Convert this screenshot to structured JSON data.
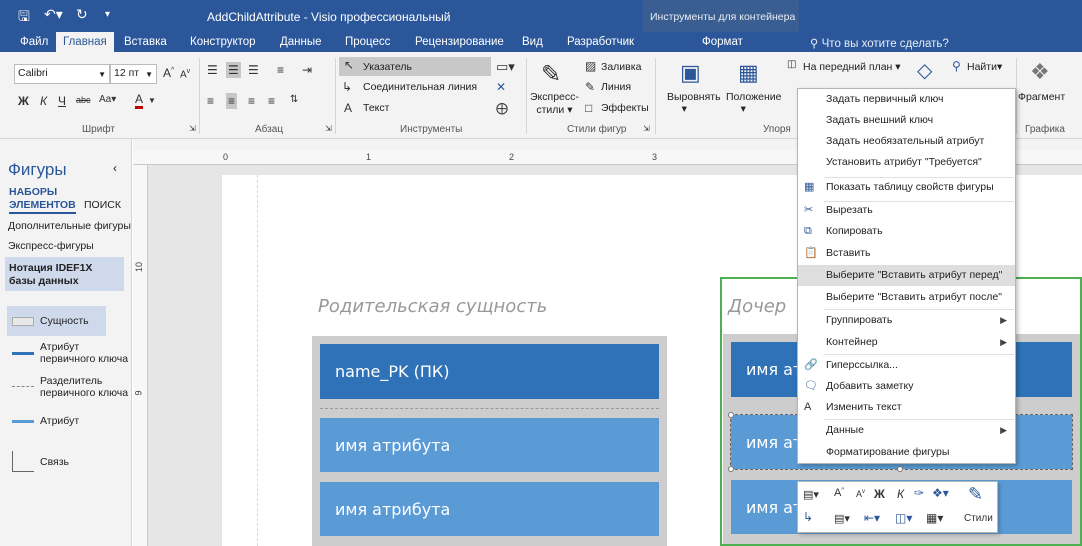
{
  "window": {
    "title": "AddChildAttribute - Visio профессиональный",
    "contextual_group": "Инструменты для контейнера"
  },
  "tabs": [
    "Файл",
    "Главная",
    "Вставка",
    "Конструктор",
    "Данные",
    "Процесс",
    "Рецензирование",
    "Вид",
    "Разработчик",
    "Формат"
  ],
  "tell_me": "Что вы хотите сделать?",
  "ribbon": {
    "font": {
      "name": "Calibri",
      "size": "12 пт",
      "label": "Шрифт"
    },
    "paragraph": {
      "label": "Абзац"
    },
    "tools": {
      "label": "Инструменты",
      "pointer": "Указатель",
      "connector": "Соединительная линия",
      "text": "Текст"
    },
    "shape_styles": {
      "label": "Стили фигур",
      "quick_styles": "Экспресс-\nстили",
      "fill": "Заливка",
      "line": "Линия",
      "effects": "Эффекты"
    },
    "arrange": {
      "label": "Упоря",
      "align": "Выровнять",
      "position": "Положение",
      "bring_front": "На передний план"
    },
    "editing": {
      "find": "Найти"
    },
    "graphic": {
      "label": "Графика",
      "fragment": "Фрагмент"
    }
  },
  "left_pane": {
    "title": "Фигуры",
    "tab_sets": "НАБОРЫ\nЭЛЕМЕНТОВ",
    "tab_search": "ПОИСК",
    "more_shapes": "Дополнительные фигуры",
    "quick_shapes": "Экспресс-фигуры",
    "stencil": "Нотация IDEF1X\nбазы данных",
    "shapes": [
      "Сущность",
      "Атрибут\nпервичного ключа",
      "Разделитель\nпервичного ключа",
      "Атрибут",
      "Связь"
    ]
  },
  "ruler": {
    "h": [
      "0",
      "1",
      "2",
      "3"
    ],
    "v": [
      "10",
      "9"
    ]
  },
  "diagram": {
    "parent_title": "Родительская сущность",
    "child_title": "Дочер",
    "pk": "name_PK (ПК)",
    "attr": "имя атрибута",
    "child_attr": "имя ат"
  },
  "context_menu": {
    "items": [
      "Задать первичный ключ",
      "Задать внешний ключ",
      "Задать необязательный атрибут",
      "Установить атрибут \"Требуется\"",
      "Показать таблицу свойств фигуры",
      "Вырезать",
      "Копировать",
      "Вставить",
      "Выберите \"Вставить атрибут перед\"",
      "Выберите \"Вставить атрибут после\"",
      "Группировать",
      "Контейнер",
      "Гиперссылка...",
      "Добавить заметку",
      "Изменить текст",
      "Данные",
      "Форматирование фигуры"
    ]
  },
  "mini_toolbar": {
    "styles": "Стили"
  },
  "colors": {
    "accent": "#2b579a",
    "entity_dark": "#2f72b8",
    "entity_light": "#5b9bd5",
    "container_green": "#4caf50"
  }
}
